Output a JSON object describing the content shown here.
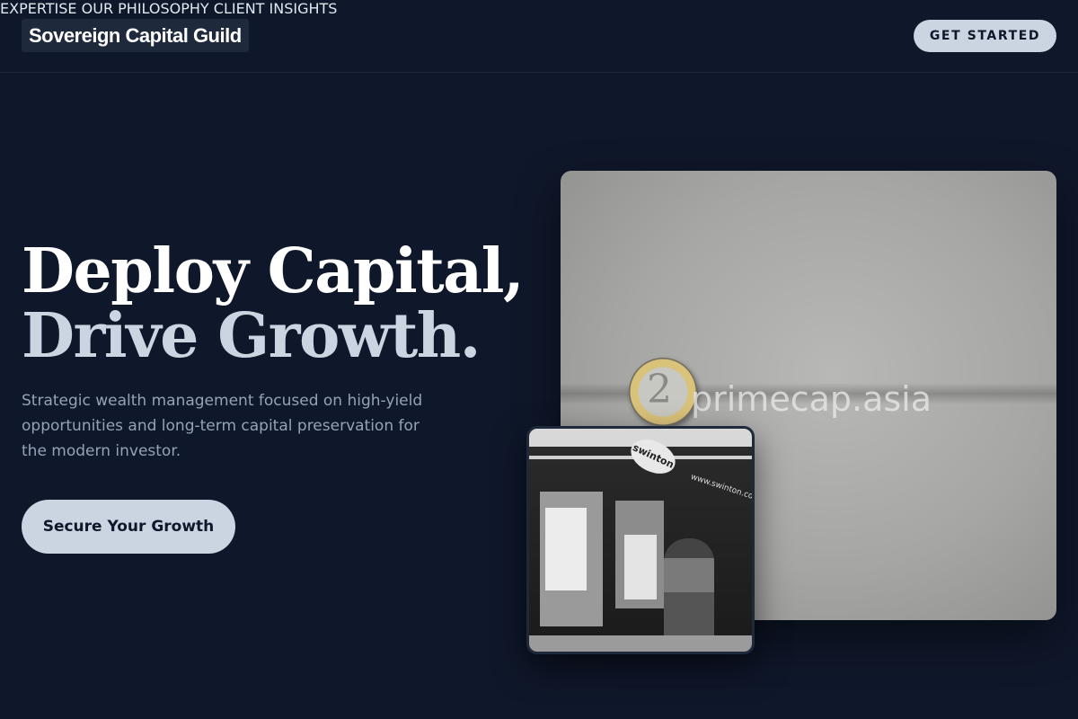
{
  "brand": {
    "name": "Sovereign Capital Guild"
  },
  "nav": {
    "items": [
      {
        "label": "EXPERTISE"
      },
      {
        "label": "OUR PHILOSOPHY"
      },
      {
        "label": "CLIENT INSIGHTS"
      }
    ],
    "cta_label": "GET STARTED"
  },
  "hero": {
    "headline_line1": "Deploy Capital,",
    "headline_line2": "Drive Growth.",
    "subtext": "Strategic wealth management focused on high-yield opportunities and long-term capital preservation for the modern investor.",
    "cta_label": "Secure Your Growth"
  },
  "images": {
    "main_watermark": "primecap.asia",
    "small_sign": "swinton",
    "small_url": "www.swinton.co.uk"
  },
  "colors": {
    "background": "#0f172a",
    "accent": "#cbd5e1",
    "muted_text": "#94a3b8"
  }
}
